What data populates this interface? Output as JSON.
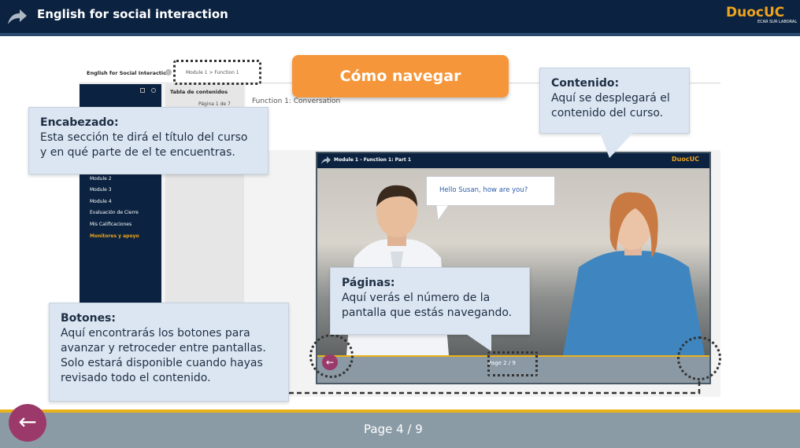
{
  "header": {
    "course_title": "English for social interaction",
    "brand": "DuocUC",
    "brand_sub": "ECAR SUR LABORAL"
  },
  "cta": {
    "label": "Cómo navegar"
  },
  "lms": {
    "course": "English for Social Interaction",
    "breadcrumb": "Module 1  >  Function 1",
    "toc_title": "Tabla de contenidos",
    "toc_page": "Página 1 de 7",
    "function_title": "Function 1: Conversation",
    "sidebar": [
      "Module 2",
      "Module 3",
      "Module 4",
      "Evaluación de Cierre",
      "Mis Calificaciones",
      "Monitores y apoyo"
    ]
  },
  "player": {
    "title": "Module 1 - Function 1:  Part 1",
    "brand": "DuocUC",
    "speech": "Hello Susan, how are you?",
    "page": "Page  2 / 9"
  },
  "callouts": {
    "encabezado": {
      "title": "Encabezado:",
      "line1": "Esta sección te dirá el título del curso",
      "line2": "y en qué parte de el te encuentras."
    },
    "contenido": {
      "title": "Contenido:",
      "line1": "Aquí se desplegará el",
      "line2": "contenido del curso."
    },
    "paginas": {
      "title": "Páginas:",
      "line1": "Aquí verás el número de la",
      "line2": "pantalla que estás navegando."
    },
    "botones": {
      "title": "Botones:",
      "line1": "Aquí encontrarás los botones para",
      "line2": "avanzar y retroceder entre pantallas.",
      "line3": "Solo estará disponible cuando hayas",
      "line4": "revisado todo el contenido."
    }
  },
  "footer": {
    "page": "Page  4 / 9"
  },
  "icons": {
    "forward": "share-arrow-icon",
    "back": "arrow-left-icon"
  },
  "colors": {
    "navy": "#0b2340",
    "accent": "#f0a31c",
    "orange": "#f5963a",
    "back_button": "#9b3a6a",
    "bottom_bar": "#8b9ba6",
    "callout": "#dce6f2"
  }
}
